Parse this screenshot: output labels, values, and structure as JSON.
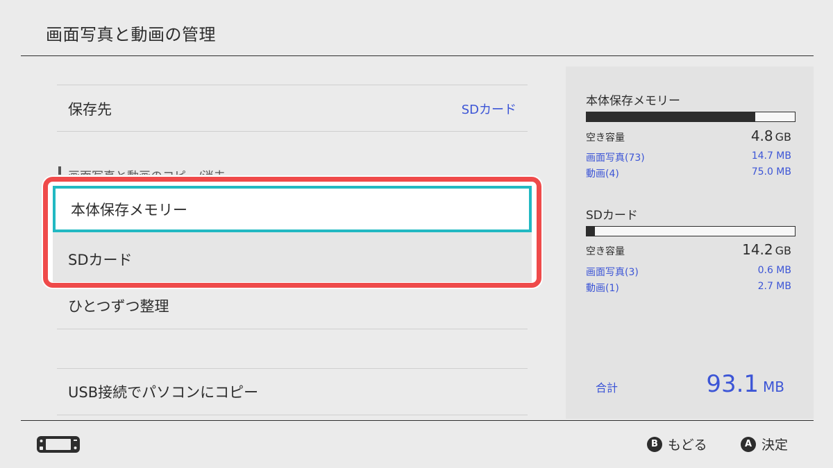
{
  "header": {
    "title": "画面写真と動画の管理"
  },
  "menu": {
    "save_location": {
      "label": "保存先",
      "value": "SDカード"
    },
    "section_heading": "画面写真と動画のコピー/消去",
    "organize": {
      "label": "ひとつずつ整理"
    },
    "usb_copy": {
      "label": "USB接続でパソコンにコピー"
    }
  },
  "popup": {
    "options": [
      {
        "label": "本体保存メモリー",
        "selected": true
      },
      {
        "label": "SDカード",
        "selected": false
      }
    ],
    "highlight_color": "#ef4a4a",
    "selection_color": "#22b9c2"
  },
  "storage": {
    "internal": {
      "title": "本体保存メモリー",
      "used_fraction": 0.81,
      "free_label": "空き容量",
      "free_value": "4.8",
      "free_unit": "GB",
      "photos_label": "画面写真(73)",
      "photos_size": "14.7 MB",
      "videos_label": "動画(4)",
      "videos_size": "75.0 MB"
    },
    "sd": {
      "title": "SDカード",
      "used_fraction": 0.04,
      "free_label": "空き容量",
      "free_value": "14.2",
      "free_unit": "GB",
      "photos_label": "画面写真(3)",
      "photos_size": "0.6 MB",
      "videos_label": "動画(1)",
      "videos_size": "2.7 MB"
    },
    "total_label": "合計",
    "total_value": "93.1",
    "total_unit": "MB"
  },
  "footer": {
    "back_button_glyph": "B",
    "back_label": "もどる",
    "confirm_button_glyph": "A",
    "confirm_label": "決定"
  },
  "colors": {
    "accent_blue": "#3c55d6",
    "background": "#ebebeb"
  }
}
